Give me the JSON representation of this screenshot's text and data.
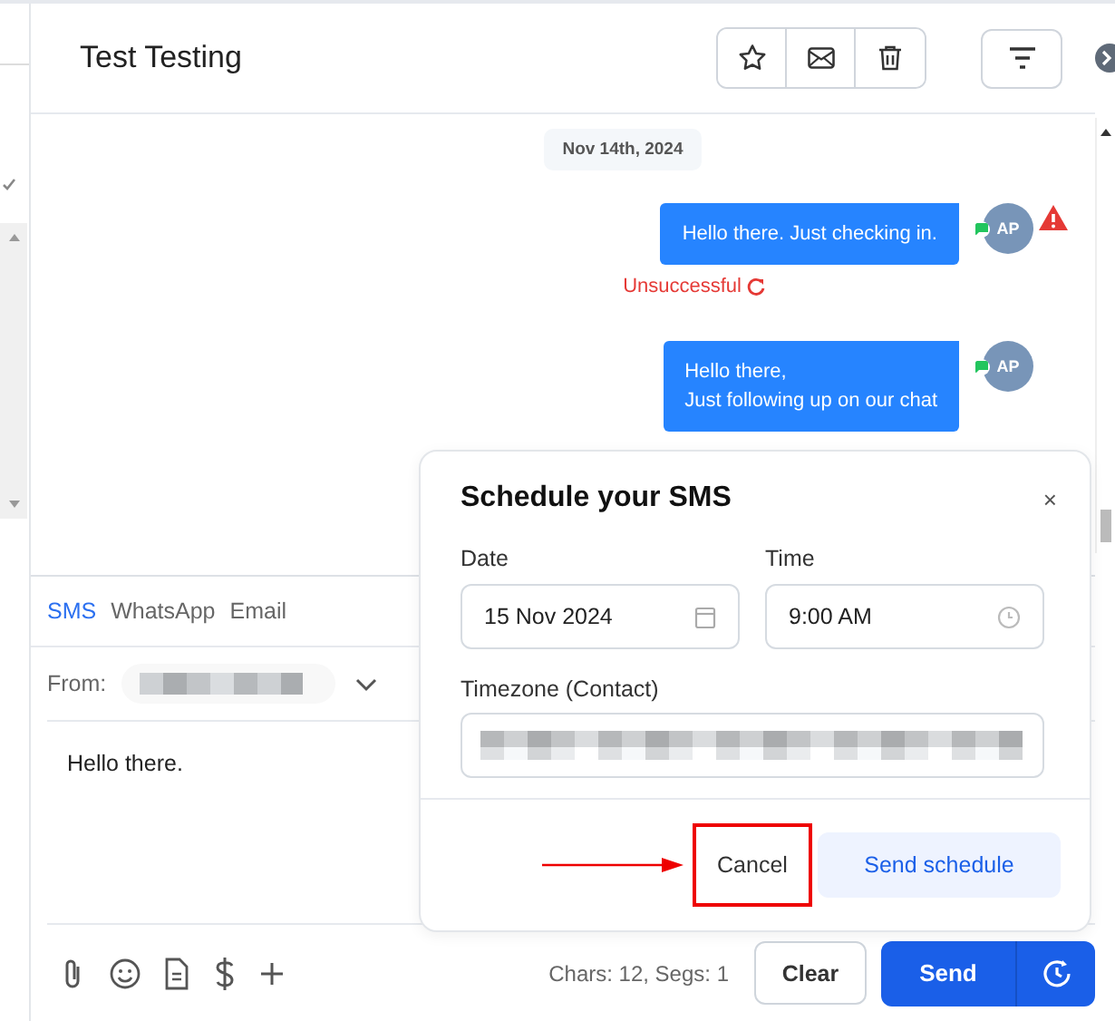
{
  "header": {
    "title": "Test Testing"
  },
  "date_divider": "Nov 14th, 2024",
  "messages": [
    {
      "text": "Hello there. Just checking in.",
      "avatar": "AP",
      "failed": true,
      "status": "Unsuccessful"
    },
    {
      "text": "Hello there,\nJust following up on our chat",
      "avatar": "AP",
      "failed": false
    }
  ],
  "composer": {
    "tabs": [
      {
        "label": "SMS",
        "selected": true
      },
      {
        "label": "WhatsApp",
        "selected": false
      },
      {
        "label": "Email",
        "selected": false
      }
    ],
    "from_label": "From:",
    "message": "Hello there.",
    "counter": "Chars: 12, Segs: 1",
    "clear": "Clear",
    "send": "Send"
  },
  "schedule_dialog": {
    "title": "Schedule your SMS",
    "close": "×",
    "date_label": "Date",
    "date_value": "15 Nov 2024",
    "time_label": "Time",
    "time_value": "9:00 AM",
    "timezone_label": "Timezone (Contact)",
    "cancel": {
      "label": "Cancel",
      "highlighted": true
    },
    "submit": "Send schedule"
  }
}
